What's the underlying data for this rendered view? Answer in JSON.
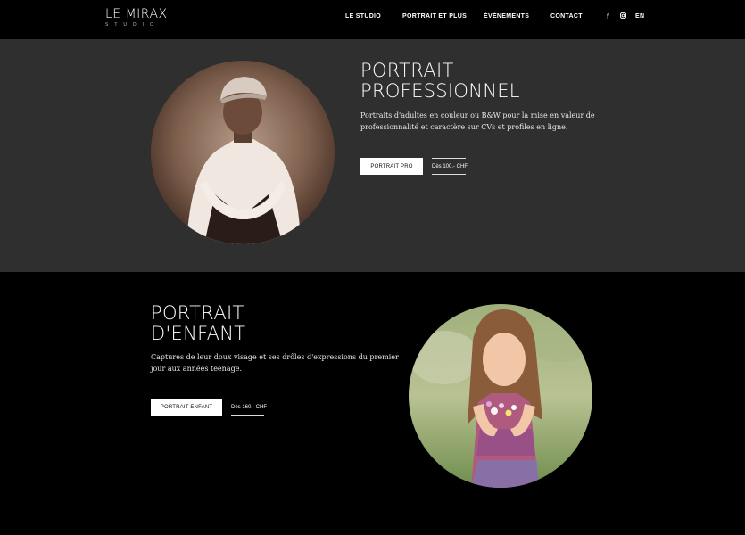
{
  "header": {
    "logo": "LE MIRAX",
    "logo_sub": "STUDIO",
    "nav": [
      "LE STUDIO",
      "PORTRAIT ET PLUS",
      "ÉVÉNEMENTS",
      "CONTACT"
    ],
    "social": {
      "facebook": "f",
      "instagram": "◙"
    },
    "lang": "EN"
  },
  "section_pro": {
    "title_line1": "PORTRAIT",
    "title_line2": "PROFESSIONNEL",
    "description_line1": "Portraits d'adultes en couleur ou B&W pour la mise en valeur de",
    "description_line2": "professionnalité et caractère sur CVs et profiles en ligne.",
    "button": "PORTRAIT PRO",
    "price": "Dès 100.- CHF"
  },
  "section_enfant": {
    "title_line1": "PORTRAIT",
    "title_line2": "D'ENFANT",
    "description_line1": "Captures de leur doux visage et ses drôles d'expressions du premier",
    "description_line2": "jour aux années teenage.",
    "button": "PORTRAIT ENFANT",
    "price": "Dès 160.- CHF"
  }
}
